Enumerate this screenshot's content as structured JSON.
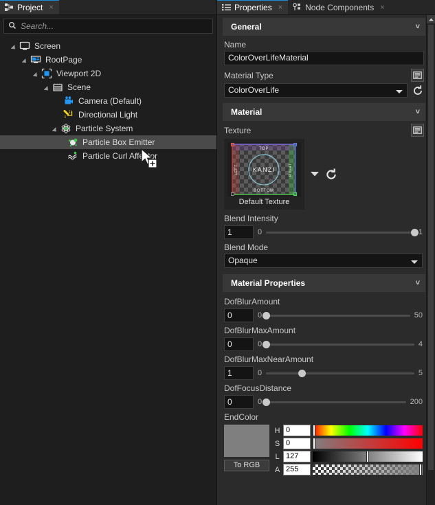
{
  "project": {
    "tab": {
      "label": "Project",
      "icon": "project-icon",
      "close": "×"
    },
    "search": {
      "placeholder": "Search...",
      "value": "",
      "icon": "search-icon"
    },
    "tree": [
      {
        "label": "Screen",
        "depth": 0,
        "icon": "screen-icon",
        "expanded": true,
        "selected": false
      },
      {
        "label": "RootPage",
        "depth": 1,
        "icon": "page-icon",
        "expanded": true,
        "selected": false
      },
      {
        "label": "Viewport 2D",
        "depth": 2,
        "icon": "viewport-icon",
        "expanded": true,
        "selected": false
      },
      {
        "label": "Scene",
        "depth": 3,
        "icon": "scene-icon",
        "expanded": true,
        "selected": false
      },
      {
        "label": "Camera (Default)",
        "depth": 4,
        "icon": "camera-icon",
        "expanded": false,
        "selected": false
      },
      {
        "label": "Directional Light",
        "depth": 4,
        "icon": "light-icon",
        "expanded": false,
        "selected": false
      },
      {
        "label": "Particle System",
        "depth": 4,
        "icon": "particle-system-icon",
        "expanded": true,
        "selected": false
      },
      {
        "label": "Particle Box Emitter",
        "depth": 5,
        "icon": "particle-emitter-icon",
        "expanded": false,
        "selected": true
      },
      {
        "label": "Particle Curl Affector",
        "depth": 5,
        "icon": "particle-affector-icon",
        "expanded": false,
        "selected": false
      }
    ]
  },
  "properties": {
    "tabs": [
      {
        "label": "Properties",
        "icon": "properties-list-icon",
        "close": "×",
        "active": true
      },
      {
        "label": "Node Components",
        "icon": "node-components-icon",
        "close": "×",
        "active": false
      }
    ],
    "sections": {
      "general": {
        "title": "General",
        "chevron": "˅"
      },
      "material": {
        "title": "Material",
        "chevron": "˅"
      },
      "material_properties": {
        "title": "Material Properties",
        "chevron": "˅"
      }
    },
    "name": {
      "label": "Name",
      "value": "ColorOverLifeMaterial"
    },
    "material_type": {
      "label": "Material Type",
      "value": "ColorOverLife",
      "browse_icon": "browse-icon",
      "reset_icon": "reset-icon"
    },
    "texture": {
      "label": "Texture",
      "browse_icon": "browse-icon",
      "caption": "Default Texture",
      "dropdown_icon": "chevron-down-icon",
      "reset_icon": "reset-icon",
      "thumb_labels": {
        "top": "TOP",
        "bottom": "BOTTOM",
        "left": "LEFT",
        "right": "RIGHT",
        "center": "KANZI"
      }
    },
    "blend_intensity": {
      "label": "Blend Intensity",
      "value": "1",
      "min": "0",
      "max": "1",
      "fill": 100
    },
    "blend_mode": {
      "label": "Blend Mode",
      "value": "Opaque"
    },
    "sliders": [
      {
        "label": "DofBlurAmount",
        "value": "0",
        "min": "0",
        "max": "50",
        "fill": 0
      },
      {
        "label": "DofBlurMaxAmount",
        "value": "0",
        "min": "0",
        "max": "4",
        "fill": 0
      },
      {
        "label": "DofBlurMaxNearAmount",
        "value": "1",
        "min": "0",
        "max": "5",
        "fill": 20
      },
      {
        "label": "DofFocusDistance",
        "value": "0",
        "min": "0",
        "max": "200",
        "fill": 0
      }
    ],
    "end_color": {
      "label": "EndColor",
      "swatch_hex": "#7f7f7f",
      "to_rgb_label": "To RGB",
      "channels": [
        {
          "name": "H",
          "value": "0",
          "mark": 1
        },
        {
          "name": "S",
          "value": "0",
          "mark": 1
        },
        {
          "name": "L",
          "value": "127",
          "mark": 50
        },
        {
          "name": "A",
          "value": "255",
          "mark": 98
        }
      ]
    },
    "scrollbar": {
      "up_arrow": "▴"
    }
  },
  "colors": {
    "panel_bg": "#2b2b2b",
    "tree_bg": "#1e1e1e",
    "selection": "#4a4a4a",
    "accent": "#1a8cd8",
    "section_header": "#383838"
  }
}
